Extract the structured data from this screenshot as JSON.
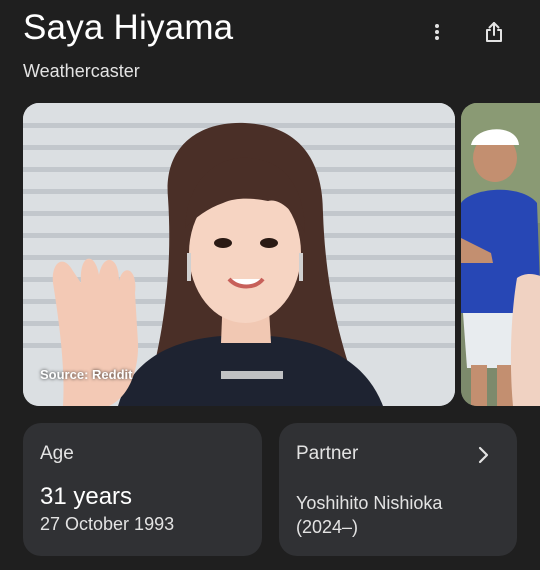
{
  "header": {
    "title": "Saya Hiyama",
    "subtitle": "Weathercaster",
    "more_icon": "more-vert-icon",
    "share_icon": "share-icon"
  },
  "images": {
    "main_source": "Source: Reddit"
  },
  "cards": {
    "age": {
      "label": "Age",
      "value": "31 years",
      "detail": "27 October 1993"
    },
    "partner": {
      "label": "Partner",
      "name": "Yoshihito Nishioka",
      "period": "(2024–)",
      "icon": "chevron-right-icon"
    }
  },
  "colors": {
    "background": "#1f1f1f",
    "card": "#303134",
    "text": "#e3e3e3"
  }
}
